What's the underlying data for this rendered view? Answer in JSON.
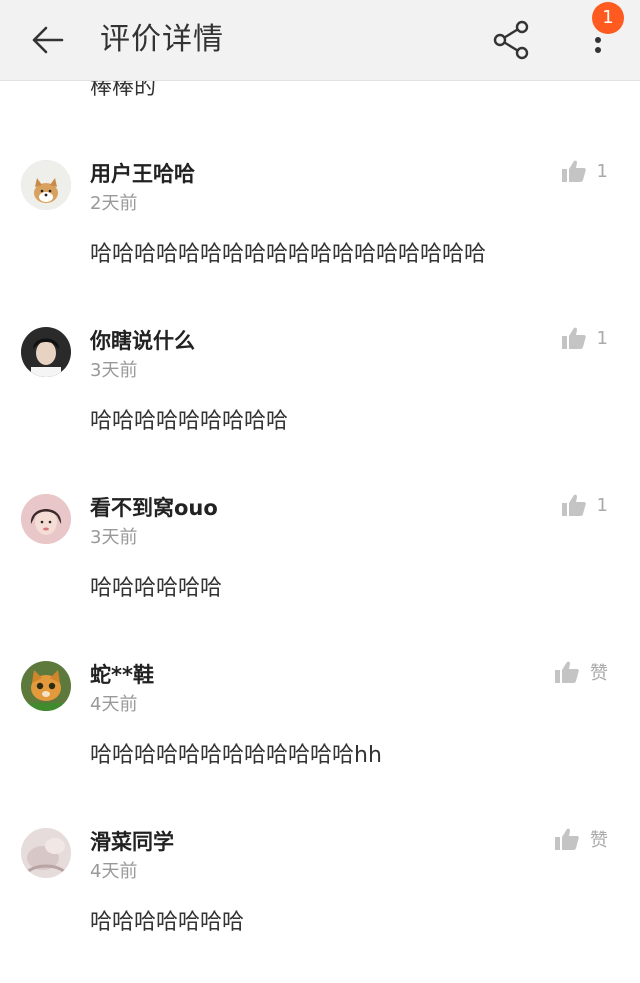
{
  "header": {
    "title": "评价详情",
    "badge_count": "1",
    "icons": {
      "back": "arrow-left-icon",
      "share": "share-icon",
      "more": "more-vertical-icon"
    }
  },
  "partial_previous_comment": "棒棒的",
  "like_icon": "thumbs-up-icon",
  "comments": [
    {
      "user": "用户王哈哈",
      "time": "2天前",
      "text": "哈哈哈哈哈哈哈哈哈哈哈哈哈哈哈哈哈哈",
      "likes": "1",
      "avatar": "shiba-dog-avatar"
    },
    {
      "user": "你瞎说什么",
      "time": "3天前",
      "text": "哈哈哈哈哈哈哈哈哈",
      "likes": "1",
      "avatar": "dark-hair-person-avatar"
    },
    {
      "user": "看不到窝ouo",
      "time": "3天前",
      "text": "哈哈哈哈哈哈",
      "likes": "1",
      "avatar": "girl-selfie-avatar"
    },
    {
      "user": "蛇**鞋",
      "time": "4天前",
      "text": "哈哈哈哈哈哈哈哈哈哈哈哈hh",
      "likes": "赞",
      "avatar": "orange-cat-avatar"
    },
    {
      "user": "滑菜同学",
      "time": "4天前",
      "text": "哈哈哈哈哈哈哈",
      "likes": "赞",
      "avatar": "pastel-photo-avatar"
    }
  ],
  "colors": {
    "badge": "#ff5a1f",
    "header_bg": "#f2f2f2",
    "muted_text": "#999999"
  }
}
